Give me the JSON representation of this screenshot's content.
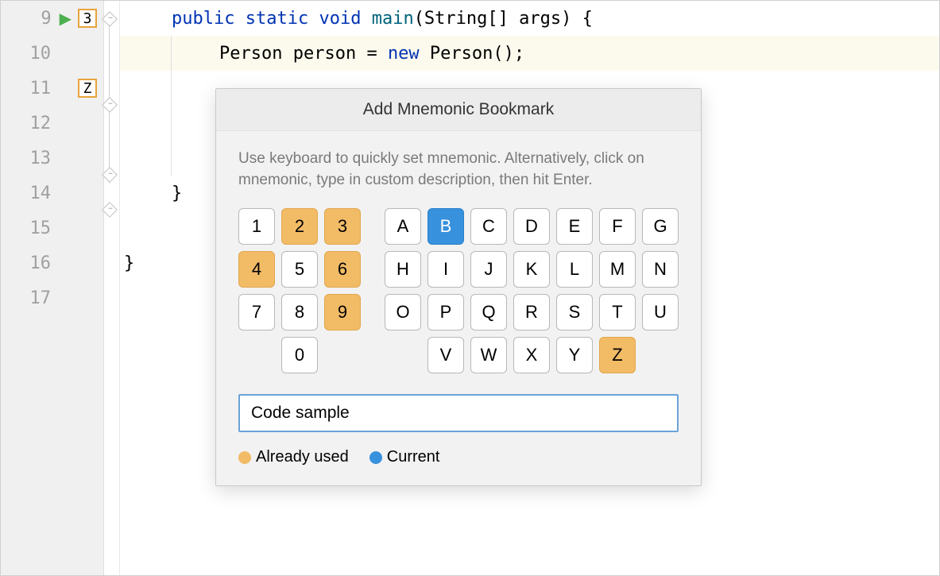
{
  "gutter": {
    "lines": [
      "9",
      "10",
      "11",
      "12",
      "13",
      "14",
      "15",
      "16",
      "17"
    ],
    "bookmark_9": "3",
    "bookmark_11": "Z"
  },
  "code": {
    "line9": {
      "kw1": "public",
      "kw2": "static",
      "kw3": "void",
      "method": "main",
      "rest": "(String[] args) {"
    },
    "line10": {
      "type": "Person",
      "var": " person = ",
      "kw": "new",
      "ctor": " Person();"
    },
    "line14": {
      "brace": "}"
    },
    "line16": {
      "brace": "}"
    }
  },
  "dialog": {
    "title": "Add Mnemonic Bookmark",
    "hint": "Use keyboard to quickly set mnemonic. Alternatively, click on mnemonic, type in custom description, then hit Enter.",
    "numbers": [
      {
        "label": "1",
        "state": ""
      },
      {
        "label": "2",
        "state": "used"
      },
      {
        "label": "3",
        "state": "used"
      },
      {
        "label": "4",
        "state": "used"
      },
      {
        "label": "5",
        "state": ""
      },
      {
        "label": "6",
        "state": "used"
      },
      {
        "label": "7",
        "state": ""
      },
      {
        "label": "8",
        "state": ""
      },
      {
        "label": "9",
        "state": "used"
      },
      {
        "label": "",
        "state": "empty"
      },
      {
        "label": "0",
        "state": ""
      },
      {
        "label": "",
        "state": "empty"
      }
    ],
    "letters": [
      {
        "label": "A",
        "state": ""
      },
      {
        "label": "B",
        "state": "current"
      },
      {
        "label": "C",
        "state": ""
      },
      {
        "label": "D",
        "state": ""
      },
      {
        "label": "E",
        "state": ""
      },
      {
        "label": "F",
        "state": ""
      },
      {
        "label": "G",
        "state": ""
      },
      {
        "label": "H",
        "state": ""
      },
      {
        "label": "I",
        "state": ""
      },
      {
        "label": "J",
        "state": ""
      },
      {
        "label": "K",
        "state": ""
      },
      {
        "label": "L",
        "state": ""
      },
      {
        "label": "M",
        "state": ""
      },
      {
        "label": "N",
        "state": ""
      },
      {
        "label": "O",
        "state": ""
      },
      {
        "label": "P",
        "state": ""
      },
      {
        "label": "Q",
        "state": ""
      },
      {
        "label": "R",
        "state": ""
      },
      {
        "label": "S",
        "state": ""
      },
      {
        "label": "T",
        "state": ""
      },
      {
        "label": "U",
        "state": ""
      },
      {
        "label": "",
        "state": "empty"
      },
      {
        "label": "V",
        "state": ""
      },
      {
        "label": "W",
        "state": ""
      },
      {
        "label": "X",
        "state": ""
      },
      {
        "label": "Y",
        "state": ""
      },
      {
        "label": "Z",
        "state": "used"
      },
      {
        "label": "",
        "state": "empty"
      }
    ],
    "description_value": "Code sample",
    "legend_used": "Already used",
    "legend_current": "Current"
  }
}
